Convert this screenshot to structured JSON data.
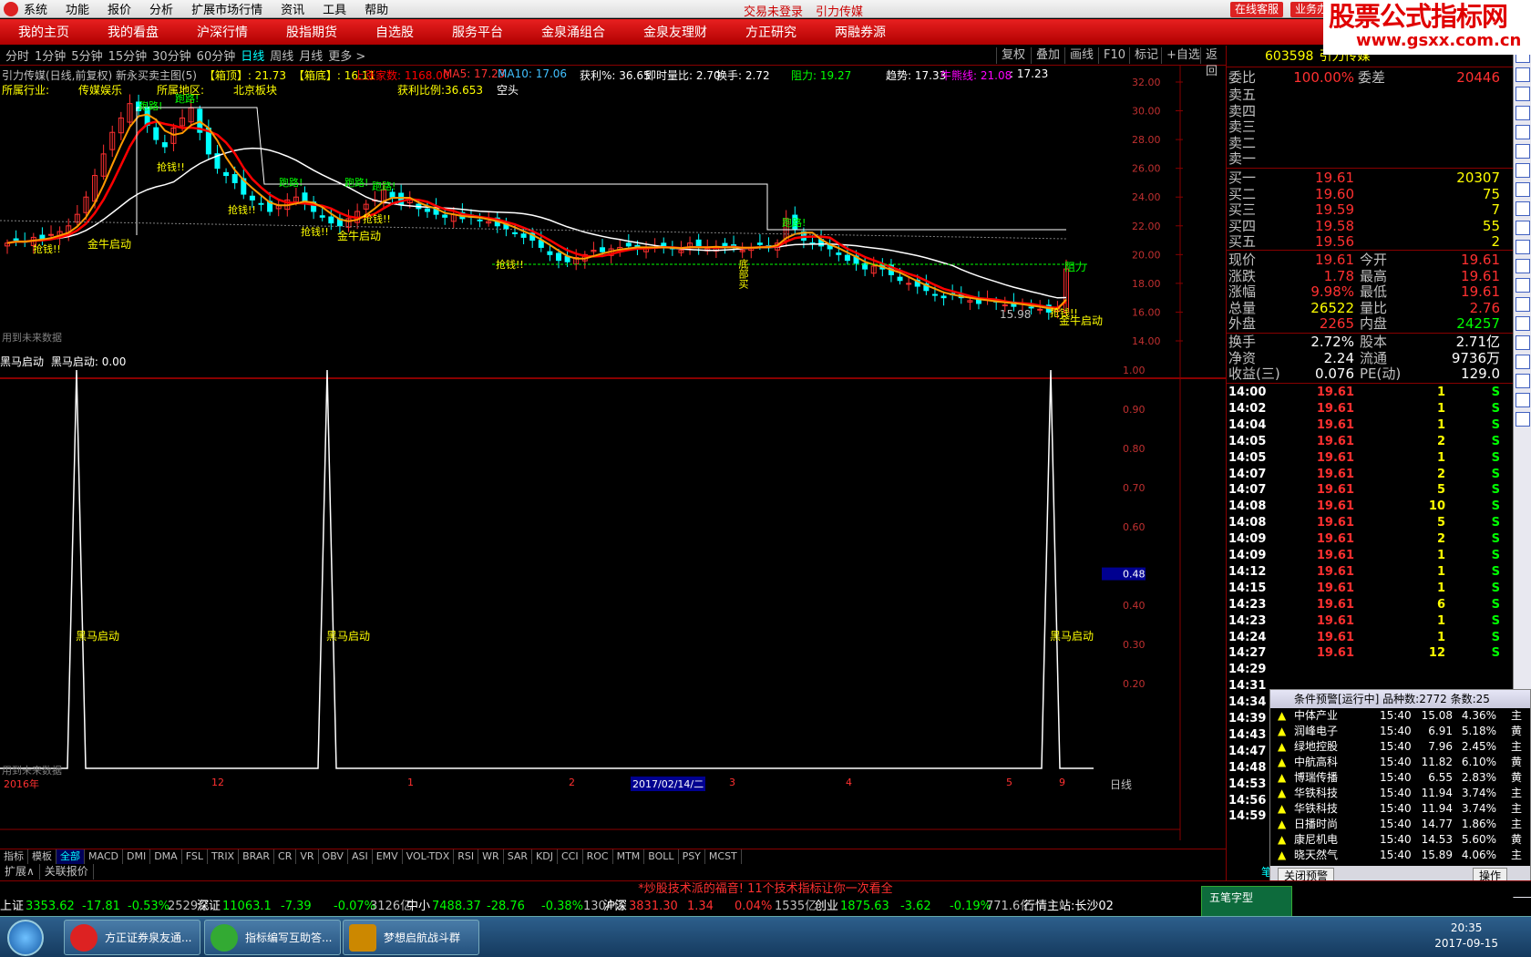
{
  "menu": {
    "items": [
      "系统",
      "功能",
      "报价",
      "分析",
      "扩展市场行情",
      "资讯",
      "工具",
      "帮助"
    ],
    "status1": "交易未登录",
    "status2": "引力传媒",
    "btn_service": "在线客服",
    "btn_business": "业务办"
  },
  "watermark": {
    "line1": "股票公式指标网",
    "line2": "www.gsxx.com.cn"
  },
  "nav": [
    "我的主页",
    "我的看盘",
    "沪深行情",
    "股指期货",
    "自选股",
    "服务平台",
    "金泉涌组合",
    "金泉友理财",
    "方正研究",
    "两融券源"
  ],
  "periods": [
    "分时",
    "1分钟",
    "5分钟",
    "15分钟",
    "30分钟",
    "60分钟",
    "日线",
    "周线",
    "月线",
    "更多 >"
  ],
  "period_active": "日线",
  "toolbar": [
    "复权",
    "叠加",
    "画线",
    "F10",
    "标记",
    "+自选",
    "返回"
  ],
  "main_header": {
    "name": "引力传媒(日线,前复权) 新永买卖主图(5)",
    "box_top": "【箱顶】: 21.73",
    "box_bot": "【箱底】: 16.11",
    "limit_up": "上涨家数: 1168.00",
    "ma5": "MA5: 17.23",
    "ma10": "MA10: 17.06",
    "profit": "获利%: 36.65",
    "vol_ratio": "即时量比: 2.70",
    "turnover": "换手: 2.72",
    "resist": "阻力: 19.27",
    "trend": "趋势: 17.33",
    "bull": "牛熊线: 21.08",
    "bull2": ": 17.23"
  },
  "main_header2": {
    "industry_lbl": "所属行业:",
    "industry": "传媒娱乐",
    "region_lbl": "所属地区:",
    "region": "北京板块",
    "profit_ratio": "获利比例:36.653",
    "state": "空头"
  },
  "price_axis": [
    "32.00",
    "30.00",
    "28.00",
    "26.00",
    "24.00",
    "22.00",
    "20.00",
    "18.00",
    "16.00",
    "14.00"
  ],
  "signals": {
    "run": "跑路!",
    "grab": "抢钱!!",
    "golden": "金牛启动",
    "up": "涨",
    "down": "跌",
    "resistance": "阻力",
    "low_mark": "15.98",
    "future": "用到未来数据",
    "bottom_buy": "底部买"
  },
  "sub_header": {
    "name": "黑马启动",
    "value_lbl": "黑马启动: 0.00"
  },
  "sub_axis": [
    "1.00",
    "0.90",
    "0.80",
    "0.70",
    "0.60",
    "0.48",
    "0.40",
    "0.30",
    "0.20"
  ],
  "sub_label": "黑马启动",
  "sub_future": "用到未来数据",
  "date_axis": {
    "year": "2016年",
    "m12": "12",
    "m1": "1",
    "m2": "2",
    "cursor": "2017/02/14/二",
    "m3": "3",
    "m4": "4",
    "m5": "5",
    "m9": "9",
    "period": "日线"
  },
  "ind_tabs": [
    "指标",
    "模板",
    "全部",
    "MACD",
    "DMI",
    "DMA",
    "FSL",
    "TRIX",
    "BRAR",
    "CR",
    "VR",
    "OBV",
    "ASI",
    "EMV",
    "VOL-TDX",
    "RSI",
    "WR",
    "SAR",
    "KDJ",
    "CCI",
    "ROC",
    "MTM",
    "BOLL",
    "PSY",
    "MCST"
  ],
  "ind_tab_active": "全部",
  "ext_tabs": [
    "扩展∧",
    "关联报价"
  ],
  "quote": {
    "code": "603598",
    "name": "引力传媒",
    "weibi_lbl": "委比",
    "weibi": "100.00%",
    "weicha_lbl": "委差",
    "weicha": "20446",
    "sell": [
      {
        "l": "卖五"
      },
      {
        "l": "卖四"
      },
      {
        "l": "卖三"
      },
      {
        "l": "卖二"
      },
      {
        "l": "卖一"
      }
    ],
    "buy": [
      {
        "l": "买一",
        "p": "19.61",
        "v": "20307"
      },
      {
        "l": "买二",
        "p": "19.60",
        "v": "75"
      },
      {
        "l": "买三",
        "p": "19.59",
        "v": "7"
      },
      {
        "l": "买四",
        "p": "19.58",
        "v": "55"
      },
      {
        "l": "买五",
        "p": "19.56",
        "v": "2"
      }
    ],
    "stats": [
      {
        "l": "现价",
        "v": "19.61",
        "l2": "今开",
        "v2": "19.61"
      },
      {
        "l": "涨跌",
        "v": "1.78",
        "l2": "最高",
        "v2": "19.61"
      },
      {
        "l": "涨幅",
        "v": "9.98%",
        "l2": "最低",
        "v2": "19.61"
      },
      {
        "l": "总量",
        "v": "26522",
        "l2": "量比",
        "v2": "2.76"
      },
      {
        "l": "外盘",
        "v": "2265",
        "l2": "内盘",
        "v2": "24257"
      }
    ],
    "stats2": [
      {
        "l": "换手",
        "v": "2.72%",
        "l2": "股本",
        "v2": "2.71亿"
      },
      {
        "l": "净资",
        "v": "2.24",
        "l2": "流通",
        "v2": "9736万"
      },
      {
        "l": "收益(三)",
        "v": "0.076",
        "l2": "PE(动)",
        "v2": "129.0"
      }
    ]
  },
  "ticks": [
    {
      "t": "14:00",
      "p": "19.61",
      "v": "1",
      "s": "S"
    },
    {
      "t": "14:02",
      "p": "19.61",
      "v": "1",
      "s": "S"
    },
    {
      "t": "14:04",
      "p": "19.61",
      "v": "1",
      "s": "S"
    },
    {
      "t": "14:05",
      "p": "19.61",
      "v": "2",
      "s": "S"
    },
    {
      "t": "14:05",
      "p": "19.61",
      "v": "1",
      "s": "S"
    },
    {
      "t": "14:07",
      "p": "19.61",
      "v": "2",
      "s": "S"
    },
    {
      "t": "14:07",
      "p": "19.61",
      "v": "5",
      "s": "S"
    },
    {
      "t": "14:08",
      "p": "19.61",
      "v": "10",
      "s": "S"
    },
    {
      "t": "14:08",
      "p": "19.61",
      "v": "5",
      "s": "S"
    },
    {
      "t": "14:09",
      "p": "19.61",
      "v": "2",
      "s": "S"
    },
    {
      "t": "14:09",
      "p": "19.61",
      "v": "1",
      "s": "S"
    },
    {
      "t": "14:12",
      "p": "19.61",
      "v": "1",
      "s": "S"
    },
    {
      "t": "14:15",
      "p": "19.61",
      "v": "1",
      "s": "S"
    },
    {
      "t": "14:23",
      "p": "19.61",
      "v": "6",
      "s": "S"
    },
    {
      "t": "14:23",
      "p": "19.61",
      "v": "1",
      "s": "S"
    },
    {
      "t": "14:24",
      "p": "19.61",
      "v": "1",
      "s": "S"
    },
    {
      "t": "14:27",
      "p": "19.61",
      "v": "12",
      "s": "S"
    },
    {
      "t": "14:29",
      "p": "",
      "v": "",
      "s": ""
    },
    {
      "t": "14:31",
      "p": "",
      "v": "",
      "s": ""
    },
    {
      "t": "14:34",
      "p": "",
      "v": "",
      "s": ""
    },
    {
      "t": "14:39",
      "p": "",
      "v": "",
      "s": ""
    },
    {
      "t": "14:43",
      "p": "",
      "v": "",
      "s": ""
    },
    {
      "t": "14:47",
      "p": "",
      "v": "",
      "s": ""
    },
    {
      "t": "14:48",
      "p": "",
      "v": "",
      "s": ""
    },
    {
      "t": "14:53",
      "p": "",
      "v": "",
      "s": ""
    },
    {
      "t": "14:56",
      "p": "",
      "v": "",
      "s": ""
    },
    {
      "t": "14:59",
      "p": "",
      "v": "",
      "s": ""
    }
  ],
  "ticks_footer": "笔",
  "alert": {
    "title": "条件预警[运行中] 品种数:2772 条数:25",
    "rows": [
      {
        "n": "中体产业",
        "t": "15:40",
        "p": "15.08",
        "c": "4.36%",
        "x": "主"
      },
      {
        "n": "润峰电子",
        "t": "15:40",
        "p": "6.91",
        "c": "5.18%",
        "x": "黄"
      },
      {
        "n": "绿地控股",
        "t": "15:40",
        "p": "7.96",
        "c": "2.45%",
        "x": "主"
      },
      {
        "n": "中航高科",
        "t": "15:40",
        "p": "11.82",
        "c": "6.10%",
        "x": "黄"
      },
      {
        "n": "博瑞传播",
        "t": "15:40",
        "p": "6.55",
        "c": "2.83%",
        "x": "黄"
      },
      {
        "n": "华铁科技",
        "t": "15:40",
        "p": "11.94",
        "c": "3.74%",
        "x": "主"
      },
      {
        "n": "华铁科技",
        "t": "15:40",
        "p": "11.94",
        "c": "3.74%",
        "x": "主"
      },
      {
        "n": "日播时尚",
        "t": "15:40",
        "p": "14.77",
        "c": "1.86%",
        "x": "主"
      },
      {
        "n": "康尼机电",
        "t": "15:40",
        "p": "14.53",
        "c": "5.60%",
        "x": "黄"
      },
      {
        "n": "晓天然气",
        "t": "15:40",
        "p": "15.89",
        "c": "4.06%",
        "x": "主"
      }
    ],
    "close": "关闭预警",
    "action": "操作"
  },
  "ticker": "*炒股技术派的福音! 11个技术指标让你一次看全",
  "indices": [
    {
      "n": "上证",
      "v": "3353.62",
      "c": "-17.81",
      "p": "-0.53%",
      "a": "2529亿"
    },
    {
      "n": "深证",
      "v": "11063.1",
      "c": "-7.39",
      "p": "-0.07%",
      "a": "3126亿"
    },
    {
      "n": "中小",
      "v": "7488.37",
      "c": "-28.76",
      "p": "-0.38%",
      "a": "1304亿"
    },
    {
      "n": "沪深",
      "v": "3831.30",
      "c": "1.34",
      "p": "0.04%",
      "a": "1535亿"
    },
    {
      "n": "创业",
      "v": "1875.63",
      "c": "-3.62",
      "p": "-0.19%",
      "a": "771.6亿"
    }
  ],
  "server": "行情主站:长沙02",
  "wubi": "五笔字型",
  "taskbar": {
    "apps": [
      "方正证券泉友通...",
      "指标编写互助答...",
      "梦想启航战斗群"
    ],
    "time": "20:35",
    "date": "2017-09-15"
  },
  "colors": {
    "up": "#ff3030",
    "down": "#00ffff",
    "ma5": "#ffff00",
    "ma10": "#ff0000",
    "ma_white": "#ffffff",
    "border": "#800000"
  },
  "chart_data": {
    "type": "candlestick",
    "price_range": [
      14,
      32
    ],
    "sub_range": [
      0,
      1
    ]
  }
}
